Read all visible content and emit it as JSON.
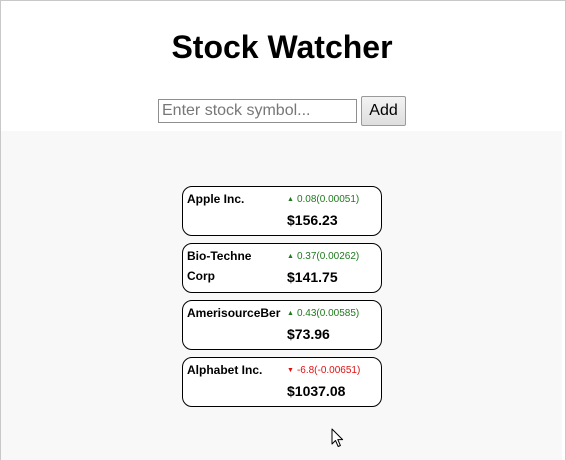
{
  "app": {
    "title": "Stock Watcher"
  },
  "search": {
    "placeholder": "Enter stock symbol...",
    "value": "",
    "add_label": "Add"
  },
  "stocks": [
    {
      "name": "Apple Inc.",
      "direction": "up",
      "arrow": "▲",
      "change": "0.08(0.00051)",
      "price": "$156.23"
    },
    {
      "name": "Bio-Techne Corp",
      "direction": "up",
      "arrow": "▲",
      "change": "0.37(0.00262)",
      "price": "$141.75"
    },
    {
      "name": "AmerisourceBer",
      "direction": "up",
      "arrow": "▲",
      "change": "0.43(0.00585)",
      "price": "$73.96"
    },
    {
      "name": "Alphabet Inc.",
      "direction": "down",
      "arrow": "▼",
      "change": "-6.8(-0.00651)",
      "price": "$1037.08"
    }
  ],
  "colors": {
    "up": "#1f7a1f",
    "down": "#e01010",
    "content_background": "#f8f8f8"
  },
  "icons": {
    "cursor": "mouse-pointer-icon"
  }
}
